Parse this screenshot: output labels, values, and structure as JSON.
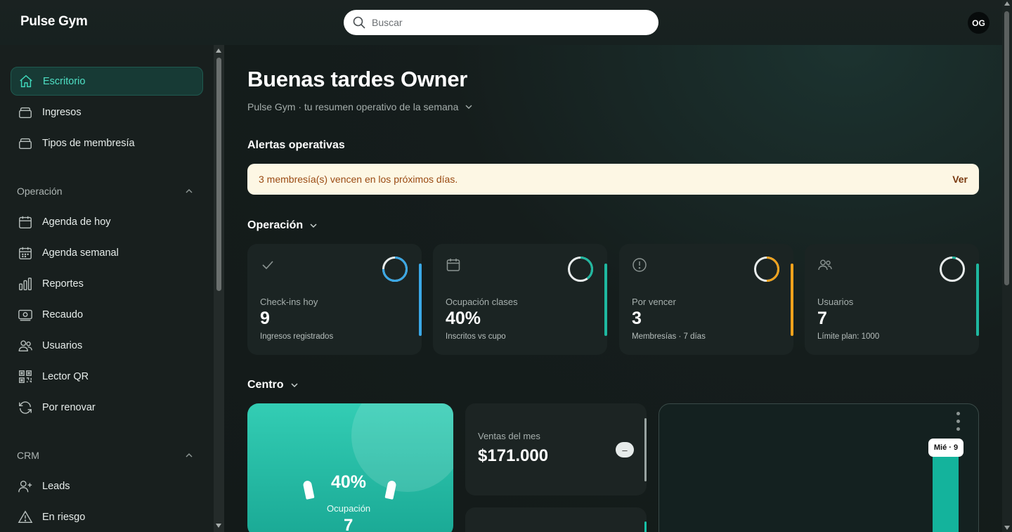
{
  "app": {
    "brand": "Pulse Gym"
  },
  "search": {
    "placeholder": "Buscar"
  },
  "user": {
    "initials": "OG"
  },
  "sidebar": {
    "items": [
      {
        "label": "Escritorio",
        "icon": "home-icon",
        "active": true
      },
      {
        "label": "Ingresos",
        "icon": "stack-icon"
      },
      {
        "label": "Tipos de membresía",
        "icon": "stack-icon"
      }
    ],
    "sections": [
      {
        "title": "Operación",
        "items": [
          {
            "label": "Agenda de hoy",
            "icon": "calendar-icon"
          },
          {
            "label": "Agenda semanal",
            "icon": "calendar-week-icon"
          },
          {
            "label": "Reportes",
            "icon": "bar-chart-icon"
          },
          {
            "label": "Recaudo",
            "icon": "cash-icon"
          },
          {
            "label": "Usuarios",
            "icon": "users-icon"
          },
          {
            "label": "Lector QR",
            "icon": "qr-icon"
          },
          {
            "label": "Por renovar",
            "icon": "refresh-icon"
          }
        ]
      },
      {
        "title": "CRM",
        "items": [
          {
            "label": "Leads",
            "icon": "user-plus-icon"
          },
          {
            "label": "En riesgo",
            "icon": "warning-icon"
          }
        ]
      }
    ]
  },
  "main": {
    "greeting": "Buenas tardes Owner",
    "subtitle": "Pulse Gym · tu resumen operativo de la semana",
    "alerts": {
      "title": "Alertas operativas",
      "message": "3 membresía(s) vencen en los próximos días.",
      "action": "Ver"
    },
    "operacion": {
      "title": "Operación",
      "cards": [
        {
          "label": "Check-ins hoy",
          "value": "9",
          "note": "Ingresos registrados",
          "icon": "check-icon",
          "color": "#3aa8e6",
          "ring": 0.75
        },
        {
          "label": "Ocupación clases",
          "value": "40%",
          "note": "Inscritos vs cupo",
          "icon": "calendar-icon",
          "color": "#1fb8a0",
          "ring": 0.4
        },
        {
          "label": "Por vencer",
          "value": "3",
          "note": "Membresías · 7 días",
          "icon": "alert-circle-icon",
          "color": "#f0a21c",
          "ring": 0.5
        },
        {
          "label": "Usuarios",
          "value": "7",
          "note": "Límite plan: 1000",
          "icon": "users-icon",
          "color": "#1fb8a0",
          "ring": 0.05
        }
      ]
    },
    "centro": {
      "title": "Centro",
      "occupancy": {
        "value": "40%",
        "label": "Ocupación",
        "count": "7"
      },
      "sales": {
        "label": "Ventas del mes",
        "value": "$171.000",
        "trend": "–"
      },
      "chart": {
        "tooltip": "Mié · 9"
      }
    }
  },
  "colors": {
    "accent": "#1fb8a0",
    "alert_bg": "#fdf7e4",
    "alert_text": "#9a4a12"
  }
}
